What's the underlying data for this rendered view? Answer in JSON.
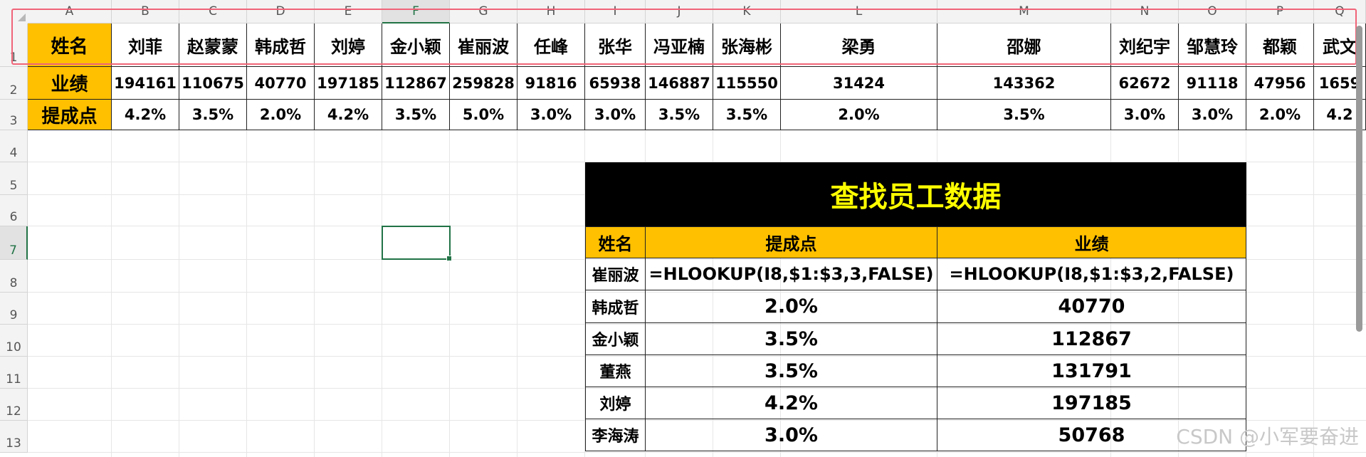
{
  "columns": [
    "A",
    "B",
    "C",
    "D",
    "E",
    "F",
    "G",
    "H",
    "I",
    "J",
    "K",
    "L",
    "M",
    "N",
    "O",
    "P",
    "Q"
  ],
  "rows": [
    "1",
    "2",
    "3",
    "4",
    "5",
    "6",
    "7",
    "8",
    "9",
    "10",
    "11",
    "12",
    "13"
  ],
  "active_column": "F",
  "active_row": "7",
  "header_labels": {
    "name": "姓名",
    "performance": "业绩",
    "commission": "提成点"
  },
  "employees": [
    {
      "name": "刘菲",
      "perf": "194161",
      "rate": "4.2%"
    },
    {
      "name": "赵蒙蒙",
      "perf": "110675",
      "rate": "3.5%"
    },
    {
      "name": "韩成哲",
      "perf": "40770",
      "rate": "2.0%"
    },
    {
      "name": "刘婷",
      "perf": "197185",
      "rate": "4.2%"
    },
    {
      "name": "金小颖",
      "perf": "112867",
      "rate": "3.5%"
    },
    {
      "name": "崔丽波",
      "perf": "259828",
      "rate": "5.0%"
    },
    {
      "name": "任峰",
      "perf": "91816",
      "rate": "3.0%"
    },
    {
      "name": "张华",
      "perf": "65938",
      "rate": "3.0%"
    },
    {
      "name": "冯亚楠",
      "perf": "146887",
      "rate": "3.5%"
    },
    {
      "name": "张海彬",
      "perf": "115550",
      "rate": "3.5%"
    },
    {
      "name": "梁勇",
      "perf": "31424",
      "rate": "2.0%"
    },
    {
      "name": "邵娜",
      "perf": "143362",
      "rate": "3.5%"
    },
    {
      "name": "刘纪宇",
      "perf": "62672",
      "rate": "3.0%"
    },
    {
      "name": "邹慧玲",
      "perf": "91118",
      "rate": "3.0%"
    },
    {
      "name": "都颖",
      "perf": "47956",
      "rate": "2.0%"
    },
    {
      "name": "武文",
      "perf": "1659",
      "rate": "4.2"
    }
  ],
  "lookup": {
    "title": "查找员工数据",
    "headers": [
      "姓名",
      "提成点",
      "业绩"
    ],
    "rows": [
      {
        "name": "崔丽波",
        "rate": "=HLOOKUP(I8,$1:$3,3,FALSE)",
        "perf": "=HLOOKUP(I8,$1:$3,2,FALSE)"
      },
      {
        "name": "韩成哲",
        "rate": "2.0%",
        "perf": "40770"
      },
      {
        "name": "金小颖",
        "rate": "3.5%",
        "perf": "112867"
      },
      {
        "name": "董燕",
        "rate": "3.5%",
        "perf": "131791"
      },
      {
        "name": "刘婷",
        "rate": "4.2%",
        "perf": "197185"
      },
      {
        "name": "李海涛",
        "rate": "3.0%",
        "perf": "50768"
      }
    ]
  },
  "watermark": "CSDN @小军要奋进",
  "colors": {
    "header_fill": "#ffc000",
    "title_fill": "#000000",
    "title_text": "#ffff00",
    "highlight_border": "#f06478",
    "selection": "#217346"
  }
}
